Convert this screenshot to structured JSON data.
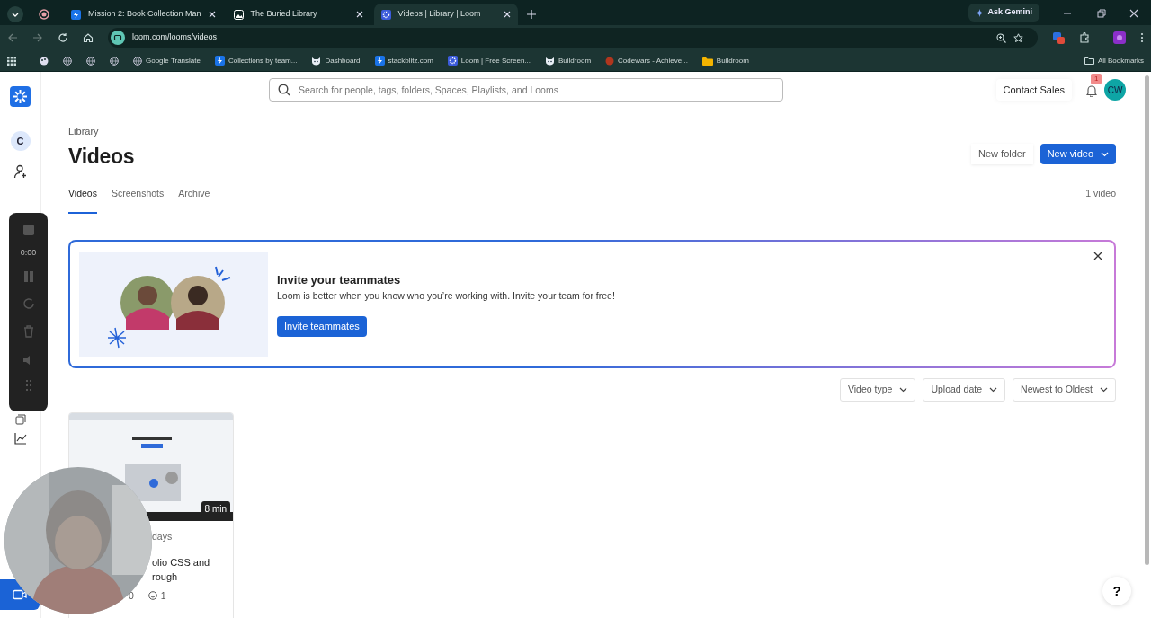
{
  "browser": {
    "tabs": [
      {
        "title": "Mission 2: Book Collection Man",
        "selected": false,
        "kind": "bolt"
      },
      {
        "title": "The Buried Library",
        "selected": false
      },
      {
        "title": "Videos | Library | Loom",
        "selected": true,
        "kind": "loom"
      }
    ],
    "ask_gemini": "Ask Gemini",
    "address": "loom.com/looms/videos",
    "bookmarks": [
      {
        "label": "Google Translate",
        "kind": "globe"
      },
      {
        "label": "Collections by team...",
        "kind": "bolt"
      },
      {
        "label": "Dashboard",
        "kind": "cat"
      },
      {
        "label": "stackblitz.com",
        "kind": "bolt"
      },
      {
        "label": "Loom | Free Screen...",
        "kind": "loom"
      },
      {
        "label": "Buildroom",
        "kind": "cat"
      },
      {
        "label": "Codewars - Achieve...",
        "kind": "red"
      },
      {
        "label": "Buildroom",
        "kind": "folder"
      }
    ],
    "all_bookmarks": "All Bookmarks"
  },
  "sidebar": {
    "avatar": "C"
  },
  "recorder": {
    "time": "0:00"
  },
  "header": {
    "search": {
      "placeholder": "Search for people, tags, folders, Spaces, Playlists, and Looms"
    },
    "contact_sales": "Contact Sales",
    "notifications": "1",
    "avatar": "CW"
  },
  "library": {
    "breadcrumb": "Library",
    "title": "Videos",
    "buttons": [
      {
        "label": "New folder",
        "kind": "plain"
      },
      {
        "label": "New video",
        "kind": "primary"
      }
    ],
    "tabs": [
      {
        "label": "Videos",
        "selected": true
      },
      {
        "label": "Screenshots",
        "selected": false
      },
      {
        "label": "Archive",
        "selected": false
      }
    ],
    "count": "1 video"
  },
  "banner": {
    "title": "Invite your teammates",
    "text": "Loom is better when you know who you’re working with. Invite your team for free!",
    "button": "Invite teammates"
  },
  "filters": [
    "Video type",
    "Upload date",
    "Newest to Oldest"
  ],
  "videos": [
    {
      "duration": "8 min",
      "age": "days",
      "title": "olio CSS and rough",
      "comments": "0",
      "reactions": "1"
    }
  ],
  "help": "?"
}
